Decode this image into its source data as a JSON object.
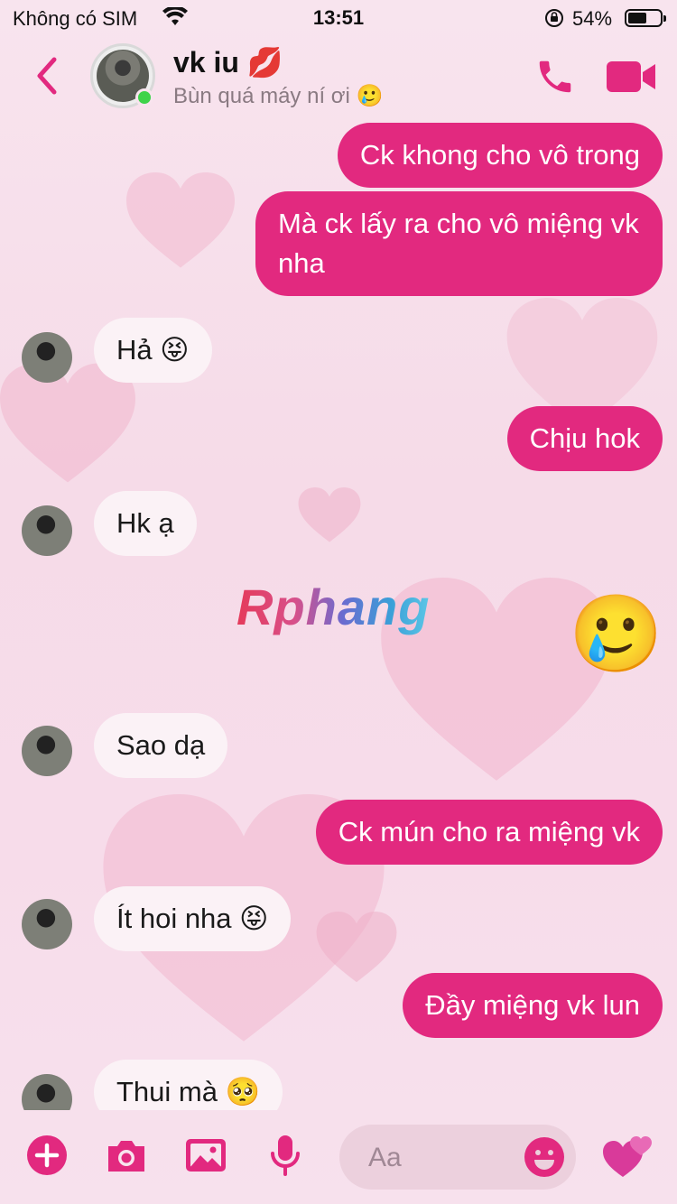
{
  "status_bar": {
    "carrier": "Không có SIM",
    "time": "13:51",
    "battery": "54%"
  },
  "header": {
    "name": "vk iu 💋",
    "status": "Bùn quá máy ní ơi 🥲"
  },
  "messages": [
    {
      "dir": "out",
      "text": "Ck khong cho vô trong"
    },
    {
      "dir": "out",
      "text": "Mà ck lấy ra cho vô miệng vk nha"
    },
    {
      "dir": "in",
      "text": "Hả 😝"
    },
    {
      "dir": "out",
      "text": "Chịu hok"
    },
    {
      "dir": "in",
      "text": "Hk ạ"
    },
    {
      "dir": "out",
      "text": "🥲"
    },
    {
      "dir": "in",
      "text": "Sao dạ"
    },
    {
      "dir": "out",
      "text": "Ck mún cho ra miệng vk"
    },
    {
      "dir": "in",
      "text": "Ít hoi nha 😝"
    },
    {
      "dir": "out",
      "text": "Đầy miệng vk lun"
    },
    {
      "dir": "in",
      "text": "Thui mà 🥺"
    }
  ],
  "watermark": "Rphang",
  "composer": {
    "placeholder": "Aa"
  },
  "colors": {
    "accent": "#e2297f",
    "incoming_bubble": "#fbf2f6",
    "background": "#f7dde9"
  },
  "icons": [
    "back-chevron-icon",
    "phone-icon",
    "video-camera-icon",
    "plus-icon",
    "camera-icon",
    "image-icon",
    "microphone-icon",
    "smiley-icon",
    "hearts-icon"
  ]
}
